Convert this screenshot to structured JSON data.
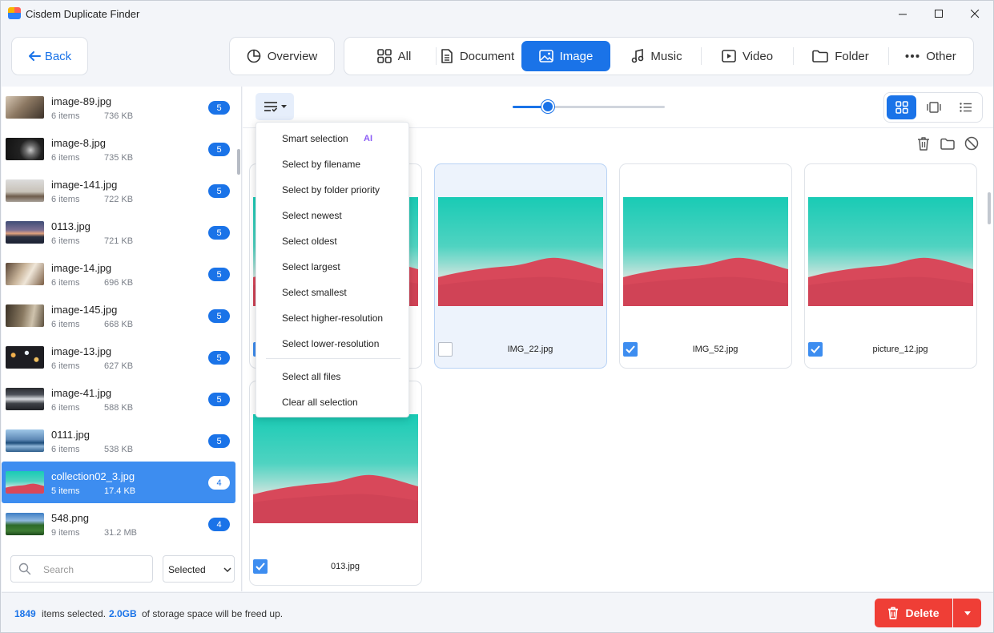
{
  "window": {
    "title": "Cisdem Duplicate Finder"
  },
  "nav": {
    "back_label": "Back",
    "overview_label": "Overview",
    "tabs": [
      {
        "label": "All",
        "icon": "grid-icon"
      },
      {
        "label": "Document",
        "icon": "document-icon"
      },
      {
        "label": "Image",
        "icon": "image-icon",
        "active": true
      },
      {
        "label": "Music",
        "icon": "music-note-icon"
      },
      {
        "label": "Video",
        "icon": "video-icon"
      },
      {
        "label": "Folder",
        "icon": "folder-icon"
      },
      {
        "label": "Other",
        "icon": "more-dots-icon"
      }
    ]
  },
  "sidebar": {
    "groups": [
      {
        "name": "image-89.jpg",
        "count": "6 items",
        "size": "736 KB",
        "badge": "5"
      },
      {
        "name": "image-8.jpg",
        "count": "6 items",
        "size": "735 KB",
        "badge": "5"
      },
      {
        "name": "image-141.jpg",
        "count": "6 items",
        "size": "722 KB",
        "badge": "5"
      },
      {
        "name": "0113.jpg",
        "count": "6 items",
        "size": "721 KB",
        "badge": "5"
      },
      {
        "name": "image-14.jpg",
        "count": "6 items",
        "size": "696 KB",
        "badge": "5"
      },
      {
        "name": "image-145.jpg",
        "count": "6 items",
        "size": "668 KB",
        "badge": "5"
      },
      {
        "name": "image-13.jpg",
        "count": "6 items",
        "size": "627 KB",
        "badge": "5"
      },
      {
        "name": "image-41.jpg",
        "count": "6 items",
        "size": "588 KB",
        "badge": "5"
      },
      {
        "name": "0111.jpg",
        "count": "6 items",
        "size": "538 KB",
        "badge": "5"
      },
      {
        "name": "collection02_3.jpg",
        "count": "5 items",
        "size": "17.4 KB",
        "badge": "4",
        "selected": true
      },
      {
        "name": "548.png",
        "count": "9 items",
        "size": "31.2 MB",
        "badge": "4"
      }
    ],
    "search_placeholder": "Search",
    "filter_value": "Selected"
  },
  "dropdown": {
    "items": [
      "Smart selection",
      "Select by filename",
      "Select by folder priority",
      "Select newest",
      "Select oldest",
      "Select largest",
      "Select smallest",
      "Select higher-resolution",
      "Select lower-resolution",
      "Select all files",
      "Clear all selection"
    ],
    "ai_badge": "AI"
  },
  "view": {
    "zoom_fraction": 0.23
  },
  "files": [
    {
      "name": "",
      "checked": true
    },
    {
      "name": "IMG_22.jpg",
      "checked": false,
      "highlighted": true
    },
    {
      "name": "IMG_52.jpg",
      "checked": true
    },
    {
      "name": "picture_12.jpg",
      "checked": true
    },
    {
      "name": "013.jpg",
      "checked": true
    }
  ],
  "status": {
    "count": "1849",
    "text1": "items selected.",
    "size": "2.0GB",
    "text2": "of storage space will be freed up.",
    "delete_label": "Delete"
  },
  "colors": {
    "accent": "#1a73e8",
    "delete": "#ef3e36",
    "ai": "#8b5cf6"
  }
}
